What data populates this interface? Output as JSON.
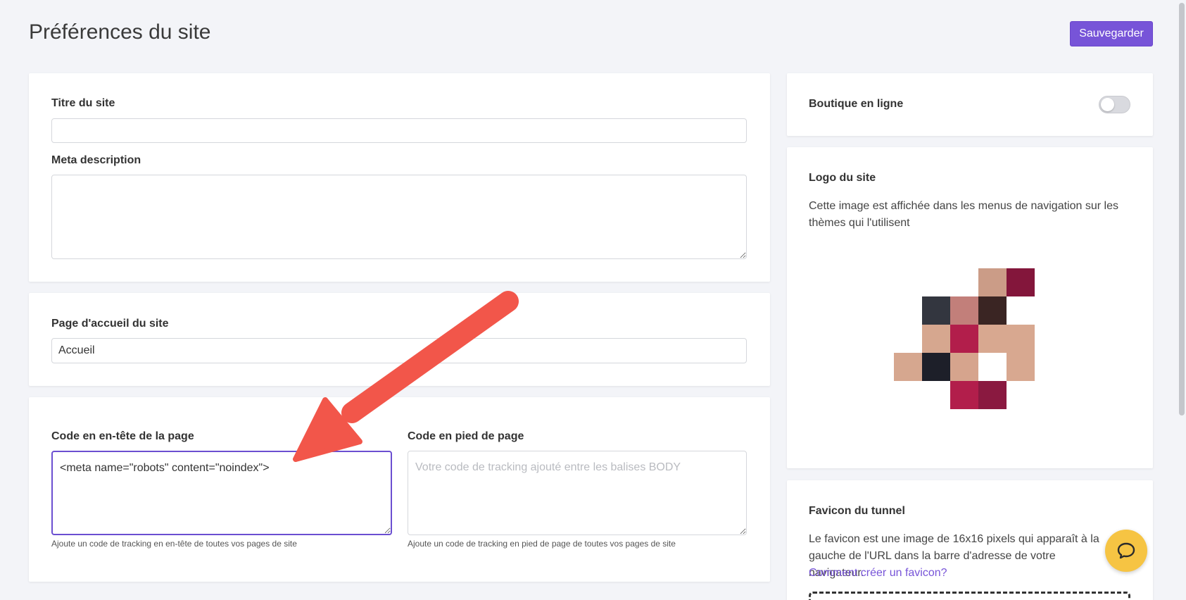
{
  "header": {
    "title": "Préférences du site",
    "save_label": "Sauvegarder"
  },
  "general": {
    "site_title_label": "Titre du site",
    "site_title_value": "",
    "meta_description_label": "Meta description",
    "meta_description_value": ""
  },
  "homepage": {
    "label": "Page d'accueil du site",
    "value": "Accueil"
  },
  "code": {
    "header_label": "Code en en-tête de la page",
    "header_value": "<meta name=\"robots\" content=\"noindex\">",
    "header_help": "Ajoute un code de tracking en en-tête de toutes vos pages de site",
    "footer_label": "Code en pied de page",
    "footer_placeholder": "Votre code de tracking ajouté entre les balises BODY",
    "footer_help": "Ajoute un code de tracking en pied de page de toutes vos pages de site"
  },
  "shop": {
    "label": "Boutique en ligne",
    "enabled": false
  },
  "logo": {
    "title": "Logo du site",
    "description": "Cette image est affichée dans les menus de navigation sur les thèmes qui l'utilisent"
  },
  "favicon": {
    "title": "Favicon du tunnel",
    "description": "Le favicon est une image de 16x16 pixels qui apparaît à la gauche de l'URL dans la barre d'adresse de votre navigateur.",
    "help_link": "Comment créer un favicon?"
  },
  "icons": {
    "chat": "chat-bubble-icon",
    "annotation": "red-arrow-annotation"
  },
  "colors": {
    "accent": "#7754d8",
    "chat_button": "#f6c443",
    "annotation_arrow": "#f2564a"
  }
}
